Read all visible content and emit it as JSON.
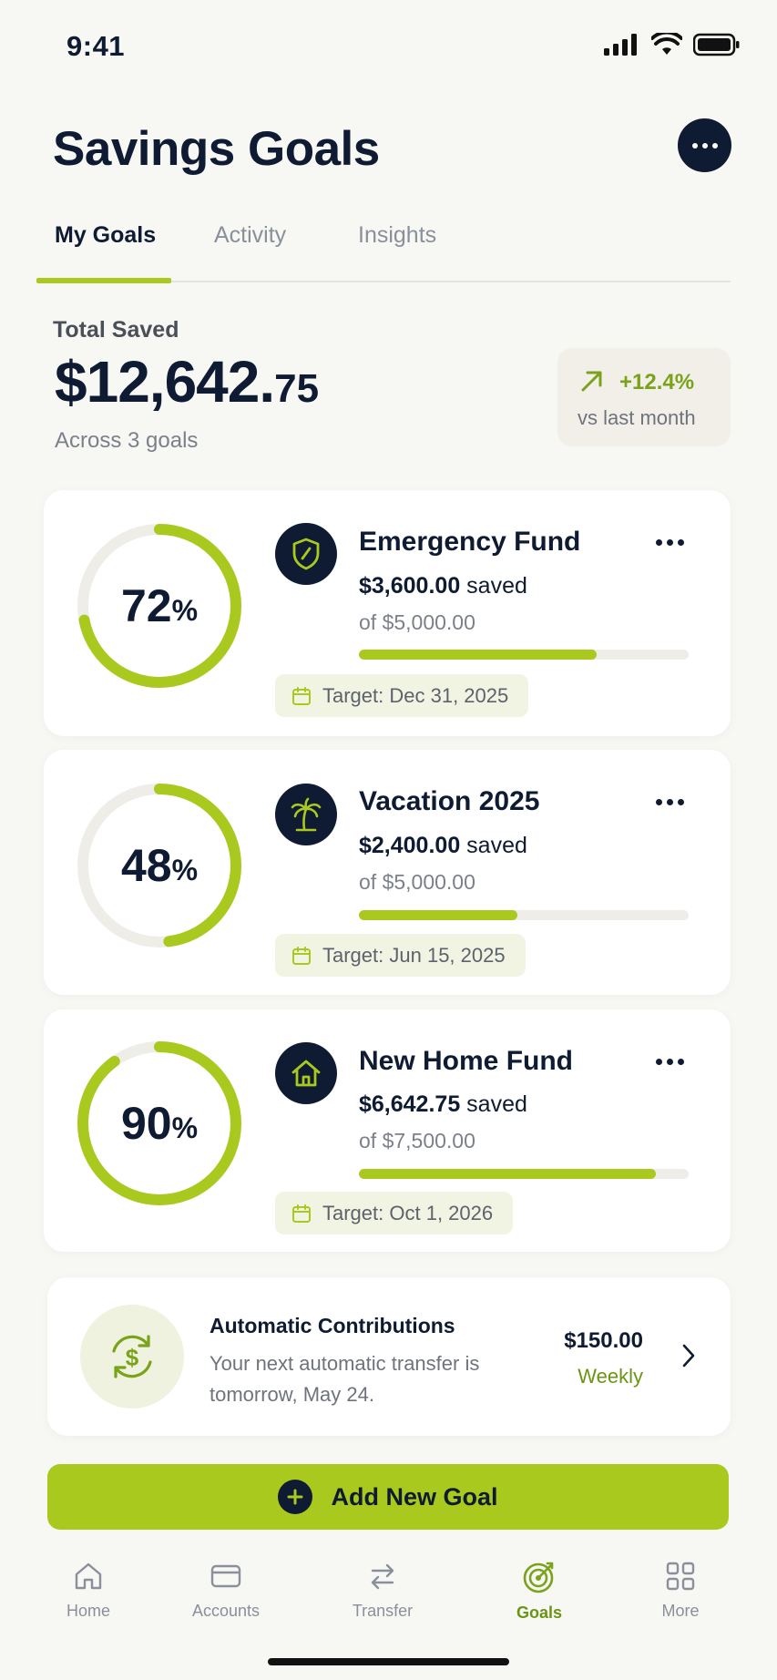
{
  "status_bar": {
    "time": "9:41"
  },
  "header": {
    "title": "Savings Goals"
  },
  "tabs": [
    {
      "label": "My Goals",
      "active": true
    },
    {
      "label": "Activity",
      "active": false
    },
    {
      "label": "Insights",
      "active": false
    }
  ],
  "summary": {
    "label": "Total Saved",
    "amount_main": "$12,642.",
    "amount_cents": "75",
    "subtext": "Across 3 goals",
    "change_pct": "+12.4%",
    "change_sub": "vs last month"
  },
  "goals": [
    {
      "name": "Emergency Fund",
      "icon": "shield-icon",
      "percent_num": "72",
      "percent_sign": "%",
      "progress": 0.72,
      "saved_amount": "$3,600.00",
      "saved_word": "saved",
      "of_total": "of $5,000.00",
      "target": "Target: Dec 31, 2025"
    },
    {
      "name": "Vacation 2025",
      "icon": "palm-tree-icon",
      "percent_num": "48",
      "percent_sign": "%",
      "progress": 0.48,
      "saved_amount": "$2,400.00",
      "saved_word": "saved",
      "of_total": "of $5,000.00",
      "target": "Target: Jun 15, 2025"
    },
    {
      "name": "New Home Fund",
      "icon": "house-icon",
      "percent_num": "90",
      "percent_sign": "%",
      "progress": 0.9,
      "saved_amount": "$6,642.75",
      "saved_word": "saved",
      "of_total": "of $7,500.00",
      "target": "Target: Oct 1, 2026"
    }
  ],
  "auto_contrib": {
    "title": "Automatic Contributions",
    "description": "Your next automatic transfer is tomorrow, May 24.",
    "amount": "$150.00",
    "frequency": "Weekly"
  },
  "add_button": {
    "label": "Add New Goal"
  },
  "nav": [
    {
      "label": "Home",
      "icon": "home-icon",
      "active": false
    },
    {
      "label": "Accounts",
      "icon": "card-icon",
      "active": false
    },
    {
      "label": "Transfer",
      "icon": "transfer-icon",
      "active": false
    },
    {
      "label": "Goals",
      "icon": "target-icon",
      "active": true
    },
    {
      "label": "More",
      "icon": "grid-icon",
      "active": false
    }
  ],
  "colors": {
    "accent": "#a9c91e",
    "navy": "#0f1b33",
    "background": "#f7f7f4",
    "track": "#efede7"
  }
}
